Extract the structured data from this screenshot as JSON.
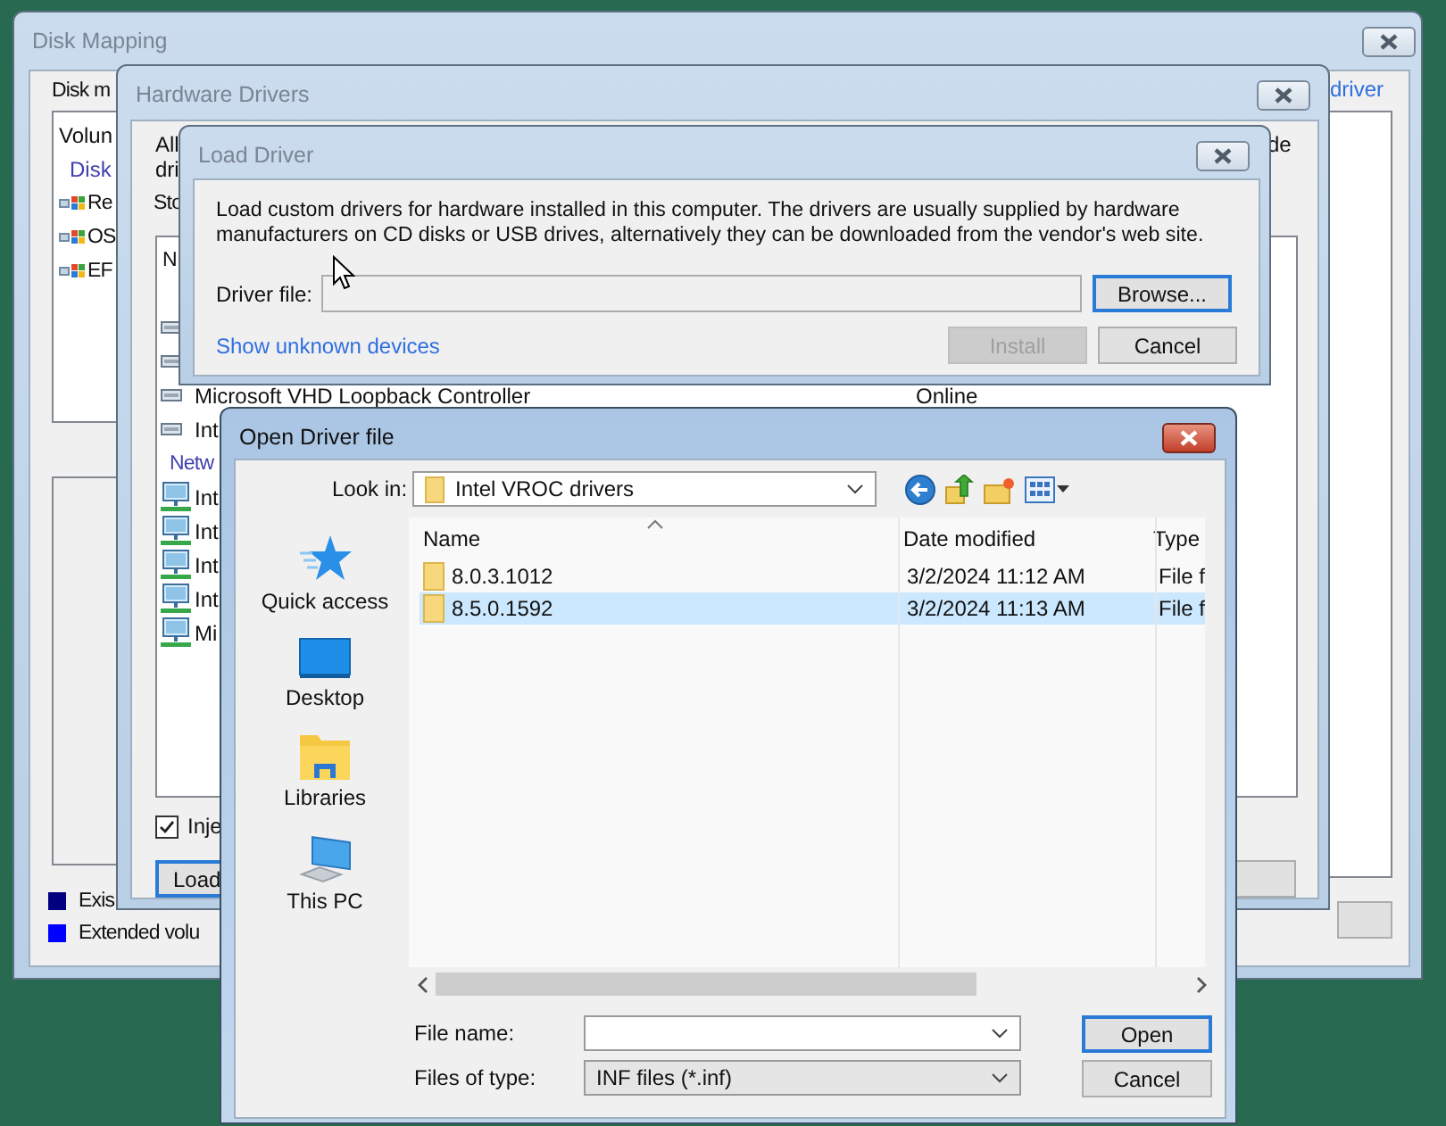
{
  "disk_mapping": {
    "title": "Disk Mapping",
    "label": "Disk m",
    "volume_list": [
      {
        "kind": "header",
        "text": "Volun"
      },
      {
        "kind": "group",
        "text": "Disk"
      },
      {
        "kind": "partition",
        "text": "Re"
      },
      {
        "kind": "partition",
        "text": "OS"
      },
      {
        "kind": "partition",
        "text": "EF"
      }
    ],
    "link": "driver",
    "legend": [
      {
        "color": "#000080",
        "label": "Exis"
      },
      {
        "color": "#0000ff",
        "label": "Extended volu"
      }
    ]
  },
  "hardware_drivers": {
    "title": "Hardware Drivers",
    "intro_lines": [
      "All",
      "dri"
    ],
    "intro_right": "de",
    "storage_label": "Sto",
    "list_header": "N",
    "rows": [
      {
        "kind": "storage"
      },
      {
        "kind": "storage"
      },
      {
        "kind": "storage",
        "name": "Microsoft VHD Loopback Controller",
        "status": "Online"
      },
      {
        "kind": "storage",
        "name": "Int"
      },
      {
        "kind": "group",
        "name": "Netw"
      },
      {
        "kind": "network",
        "name": "Int"
      },
      {
        "kind": "network",
        "name": "Int"
      },
      {
        "kind": "network",
        "name": "Int"
      },
      {
        "kind": "network",
        "name": "Int"
      },
      {
        "kind": "network",
        "name": "Mi"
      }
    ],
    "inject": {
      "label": "Inje",
      "checked": true
    },
    "load_button": "Load"
  },
  "load_driver": {
    "title": "Load Driver",
    "description": "Load custom drivers for hardware installed in this computer. The drivers are usually supplied by hardware manufacturers on CD disks or USB drives, alternatively they can be downloaded from the vendor's web site.",
    "driver_file_label": "Driver file:",
    "browse_button": "Browse...",
    "link": "Show unknown devices",
    "install_button": {
      "label": "Install",
      "disabled": true
    },
    "cancel_button": "Cancel"
  },
  "open_dialog": {
    "title": "Open Driver file",
    "look_in_label": "Look in:",
    "look_in_value": "Intel VROC drivers",
    "places": [
      {
        "kind": "quick_access",
        "label": "Quick access"
      },
      {
        "kind": "desktop",
        "label": "Desktop"
      },
      {
        "kind": "libraries",
        "label": "Libraries"
      },
      {
        "kind": "this_pc",
        "label": "This PC"
      }
    ],
    "columns": [
      "Name",
      "Date modified",
      "Type"
    ],
    "files": [
      {
        "name": "8.0.3.1012",
        "date": "3/2/2024 11:12 AM",
        "type": "File f",
        "selected": false
      },
      {
        "name": "8.5.0.1592",
        "date": "3/2/2024 11:13 AM",
        "type": "File f",
        "selected": true
      }
    ],
    "file_name_label": "File name:",
    "files_of_type_label": "Files of type:",
    "files_of_type_value": "INF files (*.inf)",
    "open_button": "Open",
    "cancel_button": "Cancel"
  }
}
